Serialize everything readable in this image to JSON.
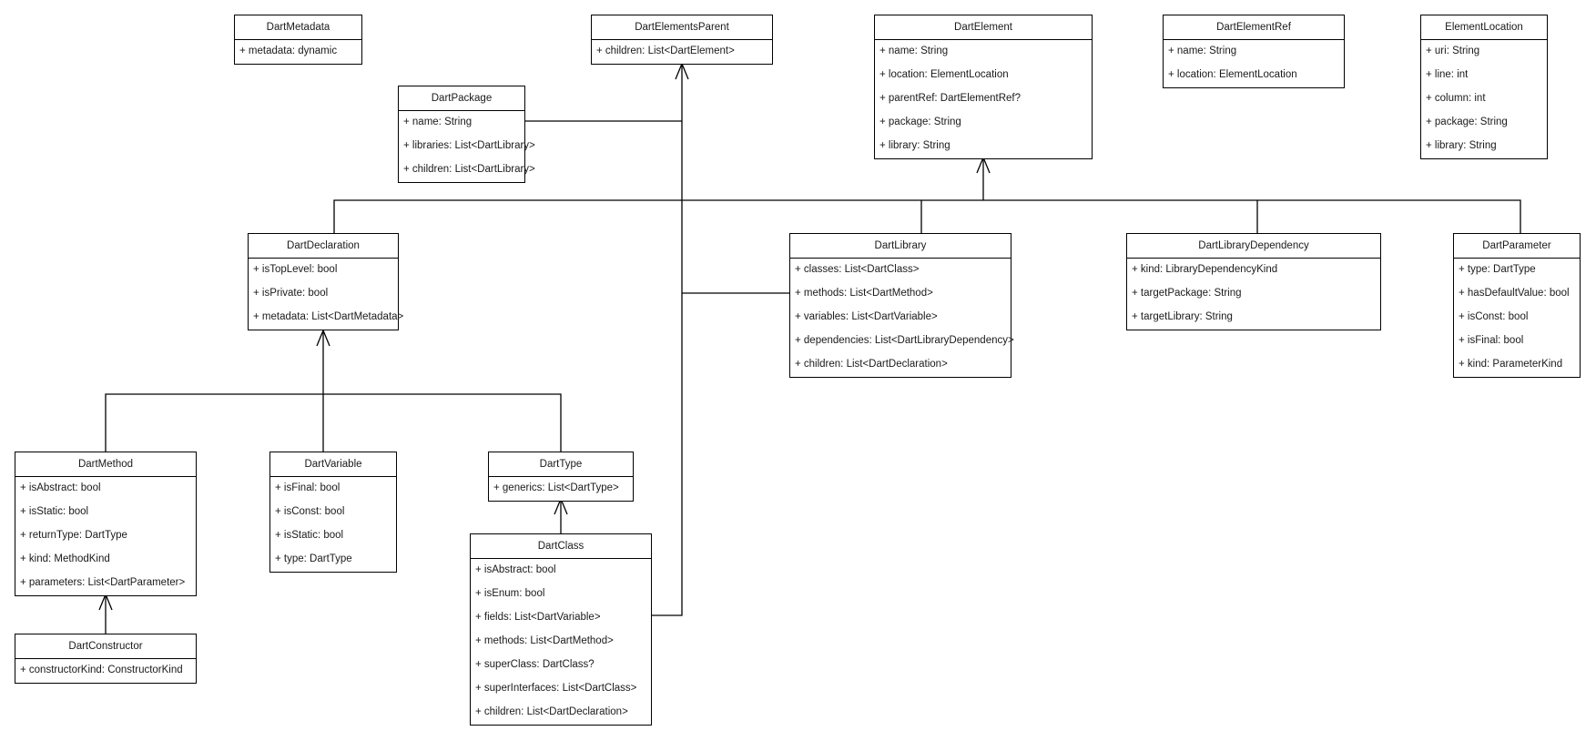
{
  "diagram": {
    "type": "UML class diagram",
    "classes": [
      {
        "id": "DartMetadata",
        "name": "DartMetadata",
        "attributes": [
          "+ metadata: dynamic"
        ]
      },
      {
        "id": "DartElementsParent",
        "name": "DartElementsParent",
        "attributes": [
          "+ children: List<DartElement>"
        ]
      },
      {
        "id": "DartElement",
        "name": "DartElement",
        "attributes": [
          "+ name: String",
          "+ location: ElementLocation",
          "+ parentRef: DartElementRef?",
          "+ package: String",
          "+ library: String"
        ]
      },
      {
        "id": "DartElementRef",
        "name": "DartElementRef",
        "attributes": [
          "+ name: String",
          "+ location: ElementLocation"
        ]
      },
      {
        "id": "ElementLocation",
        "name": "ElementLocation",
        "attributes": [
          "+ uri: String",
          "+ line: int",
          "+ column: int",
          "+ package: String",
          "+ library: String"
        ]
      },
      {
        "id": "DartPackage",
        "name": "DartPackage",
        "attributes": [
          "+ name: String",
          "+ libraries: List<DartLibrary>",
          "+ children: List<DartLibrary>"
        ]
      },
      {
        "id": "DartDeclaration",
        "name": "DartDeclaration",
        "attributes": [
          "+ isTopLevel: bool",
          "+ isPrivate: bool",
          "+ metadata: List<DartMetadata>"
        ]
      },
      {
        "id": "DartLibrary",
        "name": "DartLibrary",
        "attributes": [
          "+ classes: List<DartClass>",
          "+ methods: List<DartMethod>",
          "+ variables: List<DartVariable>",
          "+ dependencies: List<DartLibraryDependency>",
          "+ children: List<DartDeclaration>"
        ]
      },
      {
        "id": "DartLibraryDependency",
        "name": "DartLibraryDependency",
        "attributes": [
          "+ kind: LibraryDependencyKind",
          "+ targetPackage: String",
          "+ targetLibrary: String"
        ]
      },
      {
        "id": "DartParameter",
        "name": "DartParameter",
        "attributes": [
          "+ type: DartType",
          "+ hasDefaultValue: bool",
          "+ isConst: bool",
          "+ isFinal: bool",
          "+ kind: ParameterKind"
        ]
      },
      {
        "id": "DartMethod",
        "name": "DartMethod",
        "attributes": [
          "+ isAbstract: bool",
          "+ isStatic: bool",
          "+ returnType: DartType",
          "+ kind: MethodKind",
          "+ parameters: List<DartParameter>"
        ]
      },
      {
        "id": "DartVariable",
        "name": "DartVariable",
        "attributes": [
          "+ isFinal: bool",
          "+ isConst: bool",
          "+ isStatic: bool",
          "+ type: DartType"
        ]
      },
      {
        "id": "DartType",
        "name": "DartType",
        "attributes": [
          "+ generics: List<DartType>"
        ]
      },
      {
        "id": "DartClass",
        "name": "DartClass",
        "attributes": [
          "+ isAbstract: bool",
          "+ isEnum: bool",
          "+ fields: List<DartVariable>",
          "+ methods: List<DartMethod>",
          "+ superClass: DartClass?",
          "+ superInterfaces: List<DartClass>",
          "+ children: List<DartDeclaration>"
        ]
      },
      {
        "id": "DartConstructor",
        "name": "DartConstructor",
        "attributes": [
          "+ constructorKind: ConstructorKind"
        ]
      }
    ],
    "relationships": [
      {
        "from": "DartDeclaration",
        "to": "DartElement",
        "kind": "inheritance"
      },
      {
        "from": "DartLibrary",
        "to": "DartElement",
        "kind": "inheritance"
      },
      {
        "from": "DartLibraryDependency",
        "to": "DartElement",
        "kind": "inheritance"
      },
      {
        "from": "DartParameter",
        "to": "DartElement",
        "kind": "inheritance"
      },
      {
        "from": "DartPackage",
        "to": "DartElementsParent",
        "kind": "implements"
      },
      {
        "from": "DartLibrary",
        "to": "DartElementsParent",
        "kind": "implements"
      },
      {
        "from": "DartClass",
        "to": "DartElementsParent",
        "kind": "implements"
      },
      {
        "from": "DartMethod",
        "to": "DartDeclaration",
        "kind": "inheritance"
      },
      {
        "from": "DartVariable",
        "to": "DartDeclaration",
        "kind": "inheritance"
      },
      {
        "from": "DartType",
        "to": "DartDeclaration",
        "kind": "inheritance"
      },
      {
        "from": "DartClass",
        "to": "DartType",
        "kind": "inheritance"
      },
      {
        "from": "DartConstructor",
        "to": "DartMethod",
        "kind": "inheritance"
      }
    ]
  }
}
